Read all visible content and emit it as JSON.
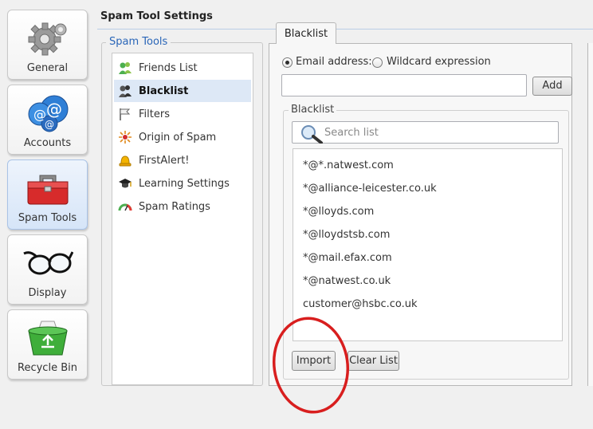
{
  "categories": [
    {
      "label": "General",
      "icon": "gear-icon"
    },
    {
      "label": "Accounts",
      "icon": "email-at-icon"
    },
    {
      "label": "Spam Tools",
      "icon": "toolbox-icon"
    },
    {
      "label": "Display",
      "icon": "glasses-icon"
    },
    {
      "label": "Recycle Bin",
      "icon": "recycle-bin-icon"
    }
  ],
  "header": {
    "title": "Spam Tool Settings"
  },
  "spam_tools": {
    "legend": "Spam Tools",
    "items": [
      {
        "label": "Friends List",
        "icon": "friends-icon"
      },
      {
        "label": "Blacklist",
        "icon": "blacklist-icon"
      },
      {
        "label": "Filters",
        "icon": "filter-flag-icon"
      },
      {
        "label": "Origin of Spam",
        "icon": "origin-burst-icon"
      },
      {
        "label": "FirstAlert!",
        "icon": "alert-bell-icon"
      },
      {
        "label": "Learning Settings",
        "icon": "graduation-cap-icon"
      },
      {
        "label": "Spam Ratings",
        "icon": "gauge-icon"
      }
    ],
    "selected": "Blacklist"
  },
  "tab": {
    "label": "Blacklist"
  },
  "options": {
    "email_label": "Email address:",
    "wildcard_label": "Wildcard expression",
    "selected": "email"
  },
  "add_button": "Add",
  "blacklist": {
    "legend": "Blacklist",
    "search_placeholder": "Search list",
    "entries": [
      "*@*.natwest.com",
      "*@alliance-leicester.co.uk",
      "*@lloyds.com",
      "*@lloydstsb.com",
      "*@mail.efax.com",
      "*@natwest.co.uk",
      "customer@hsbc.co.uk"
    ]
  },
  "buttons": {
    "import": "Import",
    "clear": "Clear List"
  },
  "colors": {
    "accent": "#2a66b8",
    "highlight_circle": "#d81e1e"
  }
}
